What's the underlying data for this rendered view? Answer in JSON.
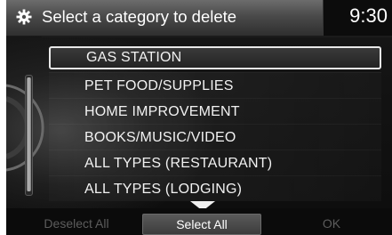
{
  "header": {
    "title": "Select a category to delete",
    "clock": "9:30",
    "icon": "gear-icon"
  },
  "list": {
    "items": [
      {
        "label": "GAS STATION",
        "selected": true
      },
      {
        "label": "PET FOOD/SUPPLIES",
        "selected": false
      },
      {
        "label": "HOME IMPROVEMENT",
        "selected": false
      },
      {
        "label": "BOOKS/MUSIC/VIDEO",
        "selected": false
      },
      {
        "label": "ALL TYPES (RESTAURANT)",
        "selected": false
      },
      {
        "label": "ALL TYPES (LODGING)",
        "selected": false
      }
    ],
    "more_below_icon": "down-arrow-icon"
  },
  "bottom_bar": {
    "deselect_all": "Deselect All",
    "select_all": "Select All",
    "ok": "OK"
  },
  "colors": {
    "background": "#0a0a0a",
    "text": "#ffffff",
    "disabled_text": "#5c5c5c",
    "selection_border": "#e8e8e8"
  }
}
